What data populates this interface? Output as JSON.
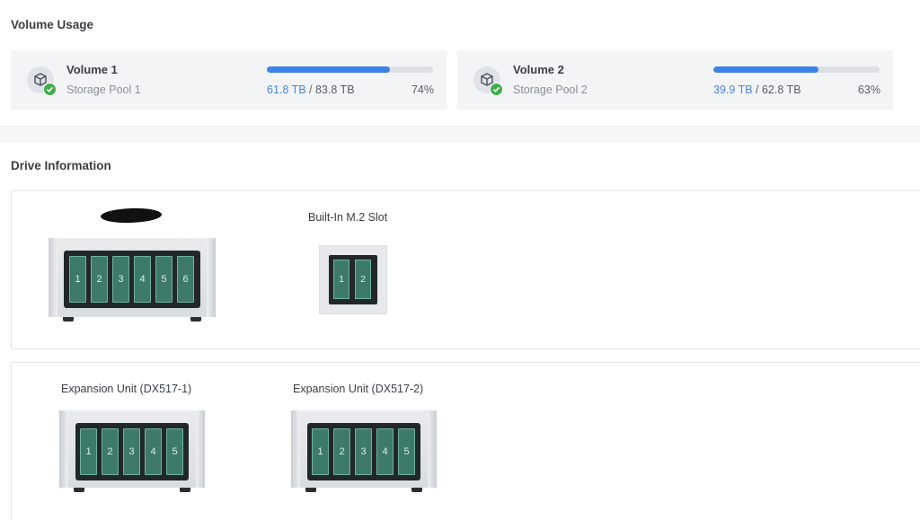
{
  "volume_usage": {
    "title": "Volume Usage",
    "volumes": [
      {
        "name": "Volume 1",
        "pool": "Storage Pool 1",
        "used": "61.8 TB",
        "separator": " / ",
        "total": "83.8 TB",
        "percent": "74%",
        "usage_fraction": 0.74,
        "status_icon": "check-circle-icon",
        "icon": "cube-icon"
      },
      {
        "name": "Volume 2",
        "pool": "Storage Pool 2",
        "used": "39.9 TB",
        "separator": " / ",
        "total": "62.8 TB",
        "percent": "63%",
        "usage_fraction": 0.63,
        "status_icon": "check-circle-icon",
        "icon": "cube-icon"
      }
    ]
  },
  "drive_information": {
    "title": "Drive Information",
    "main_unit": {
      "label_redacted": true,
      "slots": [
        "1",
        "2",
        "3",
        "4",
        "5",
        "6"
      ]
    },
    "m2": {
      "label": "Built-In M.2 Slot",
      "slots": [
        "1",
        "2"
      ]
    },
    "expansion_units": [
      {
        "label": "Expansion Unit (DX517-1)",
        "slots": [
          "1",
          "2",
          "3",
          "4",
          "5"
        ]
      },
      {
        "label": "Expansion Unit (DX517-2)",
        "slots": [
          "1",
          "2",
          "3",
          "4",
          "5"
        ]
      }
    ]
  },
  "colors": {
    "accent": "#3e81e6",
    "ok": "#3fae49",
    "drive": "#3e7a6a"
  }
}
